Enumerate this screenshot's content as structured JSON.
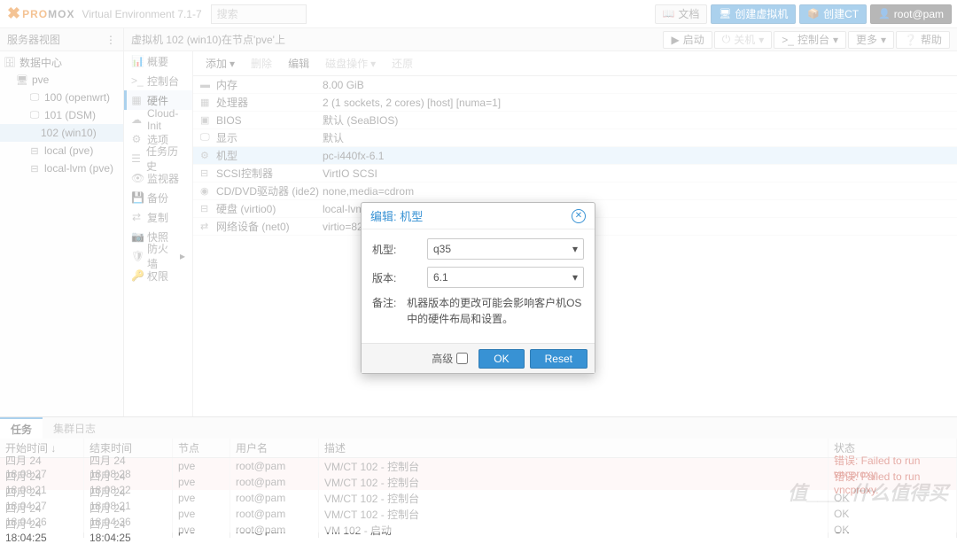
{
  "header": {
    "logo_pro": "PRO",
    "logo_mox": "MOX",
    "subtitle": "Virtual Environment 7.1-7",
    "search_placeholder": "搜索",
    "buttons": {
      "docs": "文档",
      "create_vm": "创建虚拟机",
      "create_ct": "创建CT",
      "user": "root@pam"
    }
  },
  "tree": {
    "title": "服务器视图",
    "items": [
      "数据中心",
      "pve",
      "100 (openwrt)",
      "101 (DSM)",
      "102 (win10)",
      "local (pve)",
      "local-lvm (pve)"
    ]
  },
  "crumb": {
    "text": "虚拟机 102 (win10)在节点'pve'上",
    "actions": {
      "start": "启动",
      "shutdown": "关机",
      "console": "控制台",
      "more": "更多",
      "help": "帮助"
    }
  },
  "sidemenu": [
    "概要",
    "控制台",
    "硬件",
    "Cloud-Init",
    "选项",
    "任务历史",
    "监视器",
    "备份",
    "复制",
    "快照",
    "防火墙",
    "权限"
  ],
  "hw_toolbar": {
    "add": "添加",
    "remove": "删除",
    "edit": "编辑",
    "diskaction": "磁盘操作",
    "reset": "还原"
  },
  "hw_rows": [
    {
      "k": "内存",
      "v": "8.00 GiB",
      "ic": "▬"
    },
    {
      "k": "处理器",
      "v": "2 (1 sockets, 2 cores) [host] [numa=1]",
      "ic": "▦"
    },
    {
      "k": "BIOS",
      "v": "默认 (SeaBIOS)",
      "ic": "▣"
    },
    {
      "k": "显示",
      "v": "默认",
      "ic": "🖵"
    },
    {
      "k": "机型",
      "v": "pc-i440fx-6.1",
      "ic": "⚙"
    },
    {
      "k": "SCSI控制器",
      "v": "VirtIO SCSI",
      "ic": "⊟"
    },
    {
      "k": "CD/DVD驱动器 (ide2)",
      "v": "none,media=cdrom",
      "ic": "◉"
    },
    {
      "k": "硬盘 (virtio0)",
      "v": "local-lvm:vm-102-disk-0,size=32G",
      "ic": "⊟"
    },
    {
      "k": "网络设备 (net0)",
      "v": "virtio=82:1F:44:3F:17:24,bridge=vmbr0,firewall=1",
      "ic": "⇄"
    }
  ],
  "dialog": {
    "title": "编辑: 机型",
    "fields": {
      "machine_label": "机型:",
      "machine_value": "q35",
      "version_label": "版本:",
      "version_value": "6.1",
      "note_label": "备注:",
      "note_text": "机器版本的更改可能会影响客户机OS中的硬件布局和设置。"
    },
    "advanced": "高级",
    "ok": "OK",
    "reset": "Reset"
  },
  "bottom": {
    "tabs": [
      "任务",
      "集群日志"
    ],
    "cols": {
      "start": "开始时间 ↓",
      "end": "结束时间",
      "node": "节点",
      "user": "用户名",
      "desc": "描述",
      "status": "状态"
    },
    "rows": [
      {
        "start": "四月 24 18:08:27",
        "end": "四月 24 18:08:28",
        "node": "pve",
        "user": "root@pam",
        "desc": "VM/CT 102 - 控制台",
        "status": "错误: Failed to run vncproxy.",
        "err": true
      },
      {
        "start": "四月 24 18:08:21",
        "end": "四月 24 18:08:22",
        "node": "pve",
        "user": "root@pam",
        "desc": "VM/CT 102 - 控制台",
        "status": "错误: Failed to run vncproxy.",
        "err": true
      },
      {
        "start": "四月 24 18:04:27",
        "end": "四月 24 18:08:21",
        "node": "pve",
        "user": "root@pam",
        "desc": "VM/CT 102 - 控制台",
        "status": "OK",
        "err": false
      },
      {
        "start": "四月 24 18:04:26",
        "end": "四月 24 18:04:36",
        "node": "pve",
        "user": "root@pam",
        "desc": "VM/CT 102 - 控制台",
        "status": "OK",
        "err": false
      },
      {
        "start": "四月 24 18:04:25",
        "end": "四月 24 18:04:25",
        "node": "pve",
        "user": "root@pam",
        "desc": "VM 102 - 启动",
        "status": "OK",
        "err": false
      }
    ]
  },
  "watermark": "值____什么值得买"
}
